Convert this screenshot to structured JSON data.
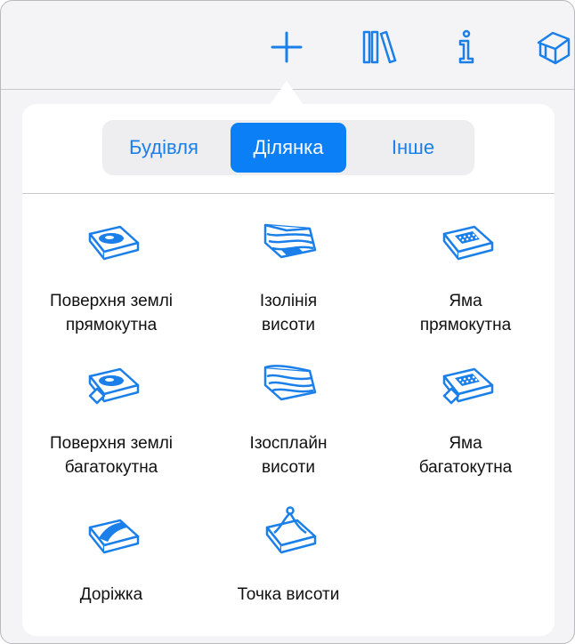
{
  "toolbar": {
    "items": [
      {
        "icon": "plus-icon"
      },
      {
        "icon": "library-icon"
      },
      {
        "icon": "info-icon"
      },
      {
        "icon": "house-icon"
      }
    ],
    "accent": "#1a7fe8"
  },
  "segments": {
    "items": [
      "Будівля",
      "Ділянка",
      "Інше"
    ],
    "selected": "Ділянка",
    "selected_color": "#0b7ff5"
  },
  "tiles": [
    {
      "label": "Поверхня землі\nпрямокутна",
      "icon": "surface-rectangular-icon"
    },
    {
      "label": "Ізолінія\nвисоти",
      "icon": "isoline-icon"
    },
    {
      "label": "Яма\nпрямокутна",
      "icon": "pit-rectangular-icon"
    },
    {
      "label": "Поверхня землі\nбагатокутна",
      "icon": "surface-polygonal-icon"
    },
    {
      "label": "Ізосплайн\nвисоти",
      "icon": "isospline-icon"
    },
    {
      "label": "Яма\nбагатокутна",
      "icon": "pit-polygonal-icon"
    },
    {
      "label": "Доріжка",
      "icon": "path-icon"
    },
    {
      "label": "Точка висоти",
      "icon": "height-point-icon"
    }
  ]
}
